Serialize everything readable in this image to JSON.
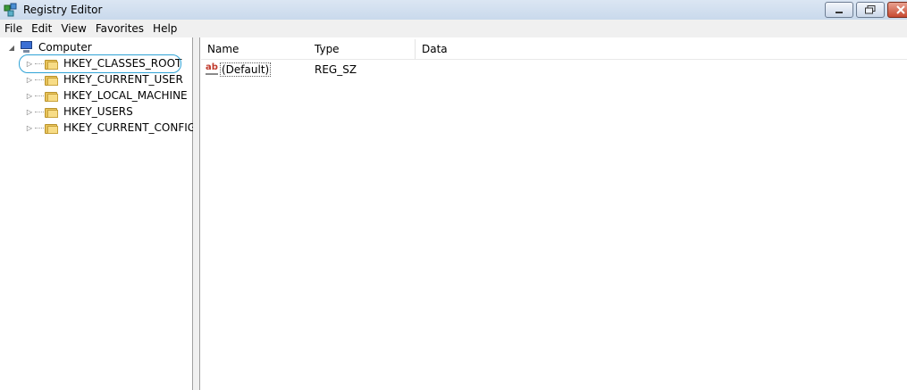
{
  "window": {
    "title": "Registry Editor",
    "icon": "registry-editor-icon"
  },
  "menu": [
    "File",
    "Edit",
    "View",
    "Favorites",
    "Help"
  ],
  "tree": {
    "root": "Computer",
    "keys": [
      "HKEY_CLASSES_ROOT",
      "HKEY_CURRENT_USER",
      "HKEY_LOCAL_MACHINE",
      "HKEY_USERS",
      "HKEY_CURRENT_CONFIG"
    ],
    "selected": "HKEY_CLASSES_ROOT"
  },
  "list": {
    "columns": [
      "Name",
      "Type",
      "Data"
    ],
    "rows": [
      {
        "name": "(Default)",
        "type": "REG_SZ",
        "data": "",
        "icon": "string-value-icon"
      }
    ]
  },
  "colors": {
    "selection_ring": "#30a3d6",
    "titlebar": "#dbe6f3"
  }
}
